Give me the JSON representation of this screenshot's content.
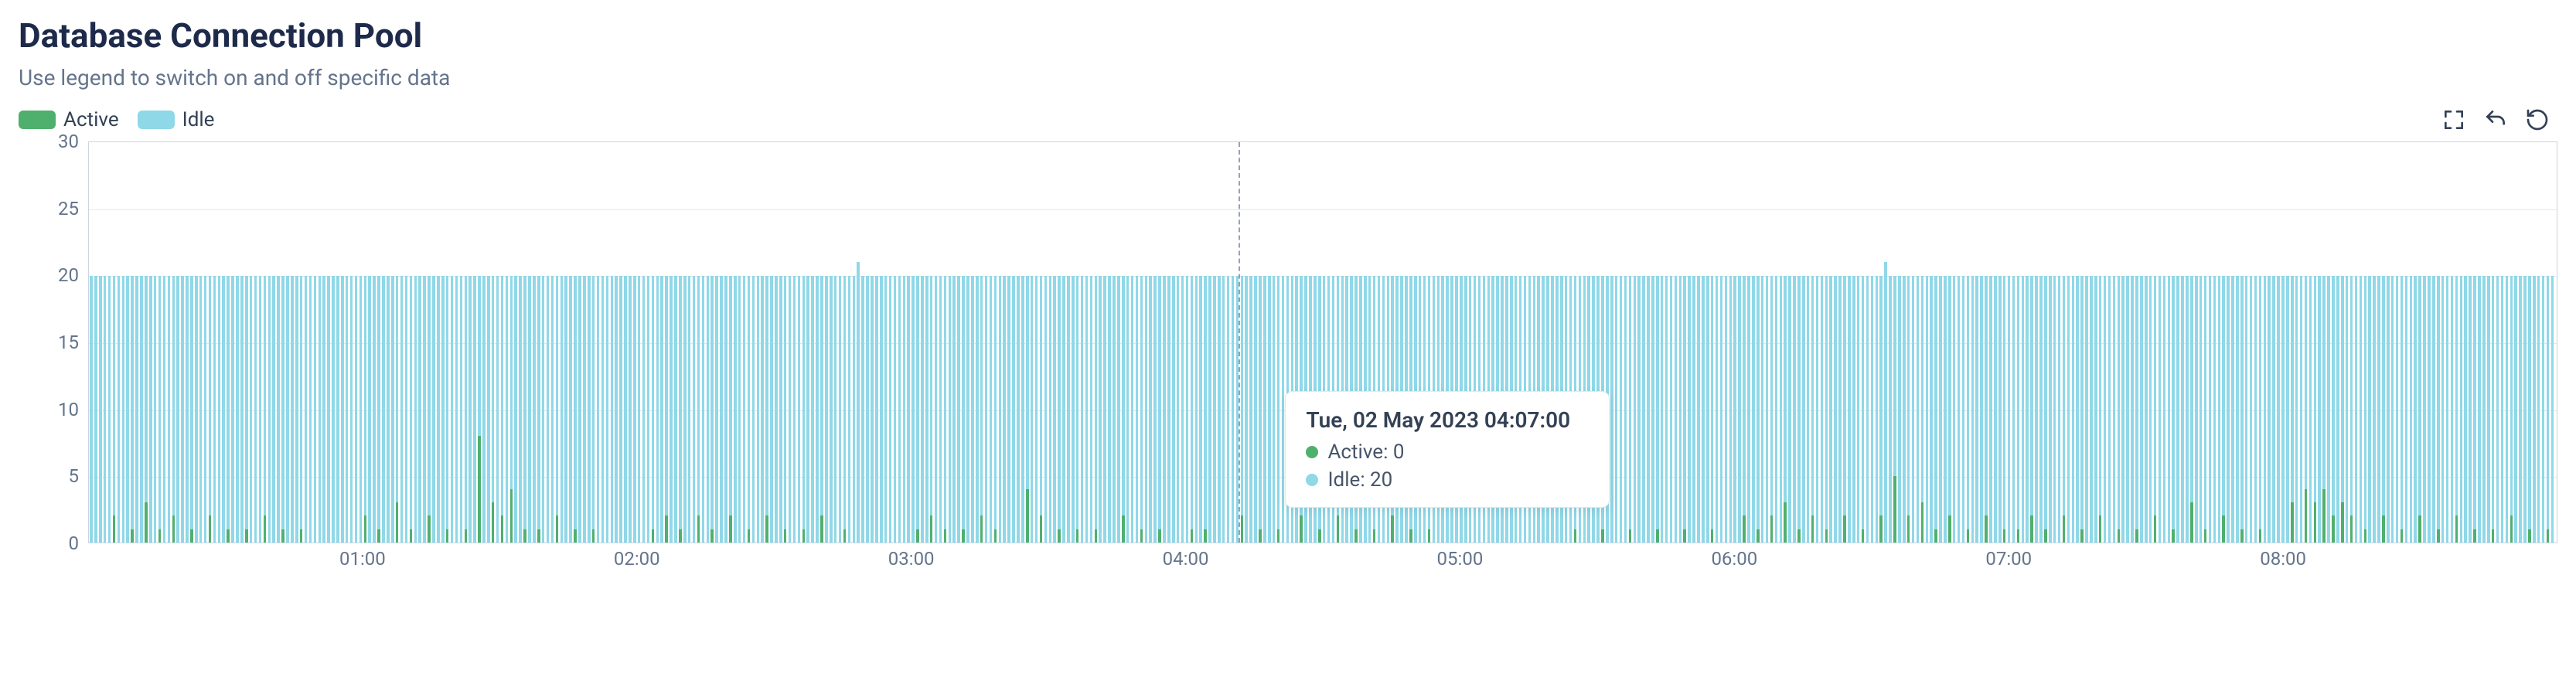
{
  "title": "Database Connection Pool",
  "subtitle": "Use legend to switch on and off specific data",
  "legend": {
    "active": {
      "label": "Active",
      "color": "#4fb06d"
    },
    "idle": {
      "label": "Idle",
      "color": "#8fd8e8"
    }
  },
  "tooltip": {
    "timestamp_label": "Tue, 02 May 2023 04:07:00",
    "active_label": "Active: 0",
    "idle_label": "Idle: 20",
    "x_fraction": 0.466
  },
  "chart_data": {
    "type": "bar",
    "title": "Database Connection Pool",
    "xlabel": "",
    "ylabel": "",
    "ylim": [
      0,
      30
    ],
    "y_ticks": [
      0,
      5,
      10,
      15,
      20,
      25,
      30
    ],
    "x_ticks": [
      "01:00",
      "02:00",
      "03:00",
      "04:00",
      "05:00",
      "06:00",
      "07:00",
      "08:00"
    ],
    "x_range_minutes": [
      0,
      540
    ],
    "series": [
      {
        "name": "Idle",
        "color": "#8fd8e8"
      },
      {
        "name": "Active",
        "color": "#4fb06d"
      }
    ],
    "interval_minutes": 1,
    "hover_point": {
      "minute": 247,
      "time": "04:07:00",
      "active": 0,
      "idle": 20
    },
    "active_spikes": [
      {
        "m": 5,
        "v": 2
      },
      {
        "m": 9,
        "v": 1
      },
      {
        "m": 12,
        "v": 3
      },
      {
        "m": 15,
        "v": 1
      },
      {
        "m": 18,
        "v": 2
      },
      {
        "m": 22,
        "v": 1
      },
      {
        "m": 26,
        "v": 2
      },
      {
        "m": 30,
        "v": 1
      },
      {
        "m": 34,
        "v": 1
      },
      {
        "m": 38,
        "v": 2
      },
      {
        "m": 42,
        "v": 1
      },
      {
        "m": 46,
        "v": 1
      },
      {
        "m": 60,
        "v": 2
      },
      {
        "m": 63,
        "v": 1
      },
      {
        "m": 67,
        "v": 3
      },
      {
        "m": 70,
        "v": 1
      },
      {
        "m": 74,
        "v": 2
      },
      {
        "m": 78,
        "v": 1
      },
      {
        "m": 82,
        "v": 1
      },
      {
        "m": 85,
        "v": 8
      },
      {
        "m": 88,
        "v": 3
      },
      {
        "m": 90,
        "v": 2
      },
      {
        "m": 92,
        "v": 4
      },
      {
        "m": 95,
        "v": 1
      },
      {
        "m": 98,
        "v": 1
      },
      {
        "m": 102,
        "v": 2
      },
      {
        "m": 106,
        "v": 1
      },
      {
        "m": 110,
        "v": 1
      },
      {
        "m": 123,
        "v": 1
      },
      {
        "m": 126,
        "v": 2
      },
      {
        "m": 129,
        "v": 1
      },
      {
        "m": 133,
        "v": 2
      },
      {
        "m": 136,
        "v": 1
      },
      {
        "m": 140,
        "v": 2
      },
      {
        "m": 144,
        "v": 1
      },
      {
        "m": 148,
        "v": 2
      },
      {
        "m": 152,
        "v": 1
      },
      {
        "m": 156,
        "v": 1
      },
      {
        "m": 160,
        "v": 2
      },
      {
        "m": 165,
        "v": 1
      },
      {
        "m": 181,
        "v": 1
      },
      {
        "m": 184,
        "v": 2
      },
      {
        "m": 187,
        "v": 1
      },
      {
        "m": 191,
        "v": 1
      },
      {
        "m": 195,
        "v": 2
      },
      {
        "m": 198,
        "v": 1
      },
      {
        "m": 205,
        "v": 4
      },
      {
        "m": 208,
        "v": 2
      },
      {
        "m": 212,
        "v": 1
      },
      {
        "m": 216,
        "v": 1
      },
      {
        "m": 220,
        "v": 1
      },
      {
        "m": 226,
        "v": 2
      },
      {
        "m": 230,
        "v": 1
      },
      {
        "m": 234,
        "v": 1
      },
      {
        "m": 241,
        "v": 1
      },
      {
        "m": 244,
        "v": 1
      },
      {
        "m": 252,
        "v": 2
      },
      {
        "m": 256,
        "v": 1
      },
      {
        "m": 260,
        "v": 1
      },
      {
        "m": 265,
        "v": 2
      },
      {
        "m": 269,
        "v": 1
      },
      {
        "m": 273,
        "v": 2
      },
      {
        "m": 277,
        "v": 1
      },
      {
        "m": 281,
        "v": 1
      },
      {
        "m": 285,
        "v": 2
      },
      {
        "m": 289,
        "v": 1
      },
      {
        "m": 293,
        "v": 1
      },
      {
        "m": 325,
        "v": 1
      },
      {
        "m": 331,
        "v": 1
      },
      {
        "m": 337,
        "v": 1
      },
      {
        "m": 343,
        "v": 1
      },
      {
        "m": 349,
        "v": 1
      },
      {
        "m": 355,
        "v": 1
      },
      {
        "m": 362,
        "v": 2
      },
      {
        "m": 365,
        "v": 1
      },
      {
        "m": 368,
        "v": 2
      },
      {
        "m": 371,
        "v": 3
      },
      {
        "m": 374,
        "v": 1
      },
      {
        "m": 377,
        "v": 2
      },
      {
        "m": 380,
        "v": 1
      },
      {
        "m": 384,
        "v": 2
      },
      {
        "m": 388,
        "v": 1
      },
      {
        "m": 392,
        "v": 2
      },
      {
        "m": 395,
        "v": 5
      },
      {
        "m": 398,
        "v": 2
      },
      {
        "m": 401,
        "v": 3
      },
      {
        "m": 404,
        "v": 1
      },
      {
        "m": 407,
        "v": 2
      },
      {
        "m": 411,
        "v": 1
      },
      {
        "m": 415,
        "v": 2
      },
      {
        "m": 419,
        "v": 1
      },
      {
        "m": 422,
        "v": 1
      },
      {
        "m": 425,
        "v": 2
      },
      {
        "m": 428,
        "v": 1
      },
      {
        "m": 432,
        "v": 2
      },
      {
        "m": 436,
        "v": 1
      },
      {
        "m": 440,
        "v": 2
      },
      {
        "m": 444,
        "v": 1
      },
      {
        "m": 448,
        "v": 1
      },
      {
        "m": 452,
        "v": 2
      },
      {
        "m": 456,
        "v": 1
      },
      {
        "m": 460,
        "v": 3
      },
      {
        "m": 463,
        "v": 1
      },
      {
        "m": 467,
        "v": 2
      },
      {
        "m": 471,
        "v": 1
      },
      {
        "m": 475,
        "v": 1
      },
      {
        "m": 482,
        "v": 3
      },
      {
        "m": 485,
        "v": 4
      },
      {
        "m": 487,
        "v": 3
      },
      {
        "m": 489,
        "v": 4
      },
      {
        "m": 491,
        "v": 2
      },
      {
        "m": 493,
        "v": 3
      },
      {
        "m": 495,
        "v": 2
      },
      {
        "m": 498,
        "v": 1
      },
      {
        "m": 502,
        "v": 2
      },
      {
        "m": 506,
        "v": 1
      },
      {
        "m": 510,
        "v": 2
      },
      {
        "m": 514,
        "v": 1
      },
      {
        "m": 518,
        "v": 2
      },
      {
        "m": 522,
        "v": 1
      },
      {
        "m": 526,
        "v": 1
      },
      {
        "m": 530,
        "v": 2
      },
      {
        "m": 534,
        "v": 1
      },
      {
        "m": 538,
        "v": 1
      }
    ],
    "idle_default": 20,
    "idle_exceptions": [
      {
        "m": 168,
        "v": 21
      },
      {
        "m": 393,
        "v": 21
      }
    ]
  }
}
